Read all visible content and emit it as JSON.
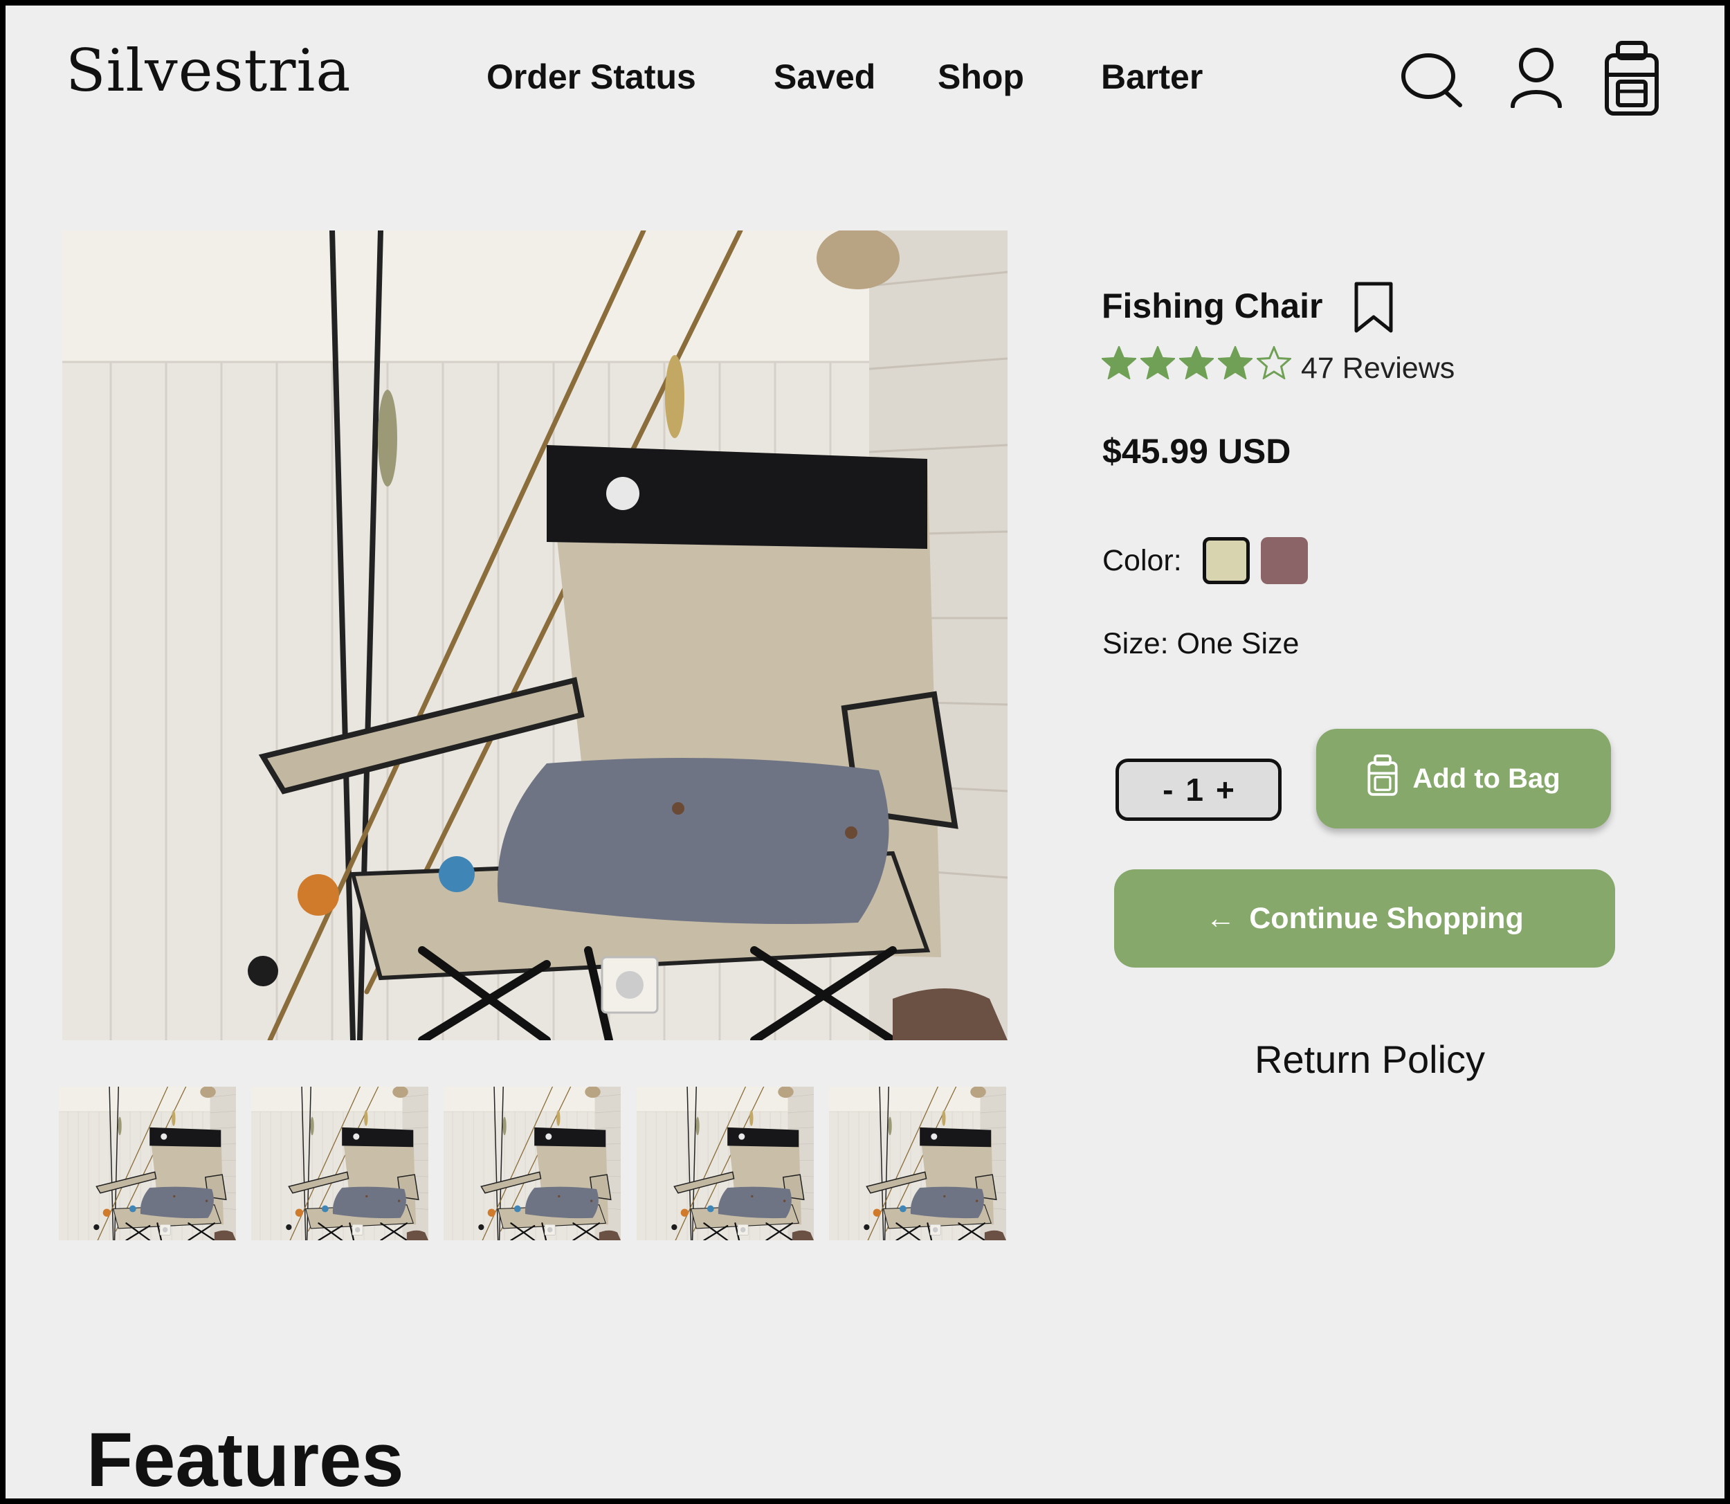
{
  "header": {
    "logo": "Silvestria",
    "nav": [
      "Order Status",
      "Saved",
      "Shop",
      "Barter"
    ],
    "icons": [
      "search-icon",
      "user-icon",
      "backpack-icon"
    ]
  },
  "product": {
    "title": "Fishing Chair",
    "rating": 4,
    "rating_max": 5,
    "reviews": "47 Reviews",
    "price": "$45.99 USD",
    "color_label": "Color:",
    "colors": [
      "#d9d4b0",
      "#8a6466"
    ],
    "selected_color": 0,
    "size_label": "Size: One Size",
    "quantity": {
      "minus": "-",
      "value": "1",
      "plus": "+"
    },
    "add_to_bag": "Add to Bag",
    "continue_shopping": "Continue Shopping",
    "continue_arrow": "←",
    "return_policy": "Return Policy",
    "thumbnail_count": 5
  },
  "section": {
    "features": "Features"
  },
  "colors": {
    "accent": "#86a86b",
    "star": "#6fa055",
    "background": "#eeeeee"
  }
}
